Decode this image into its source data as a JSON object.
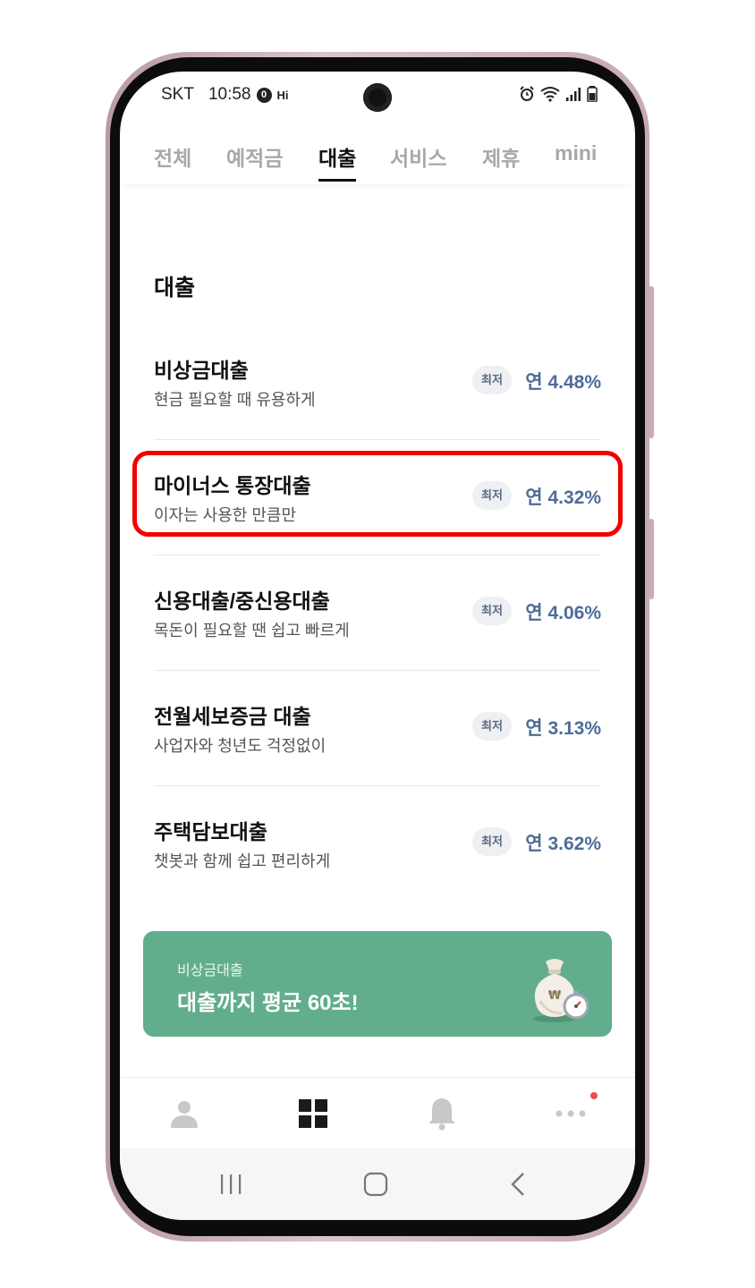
{
  "status_bar": {
    "carrier": "SKT",
    "time": "10:58",
    "hi_label": "Hi"
  },
  "tabs": [
    {
      "label": "전체",
      "active": false
    },
    {
      "label": "예적금",
      "active": false
    },
    {
      "label": "대출",
      "active": true
    },
    {
      "label": "서비스",
      "active": false
    },
    {
      "label": "제휴",
      "active": false
    },
    {
      "label": "mini",
      "active": false
    }
  ],
  "section": {
    "title": "대출"
  },
  "loans": [
    {
      "name": "비상금대출",
      "desc": "현금 필요할 때 유용하게",
      "badge": "최저",
      "rate": "연 4.48%"
    },
    {
      "name": "마이너스 통장대출",
      "desc": "이자는 사용한 만큼만",
      "badge": "최저",
      "rate": "연 4.32%"
    },
    {
      "name": "신용대출/중신용대출",
      "desc": "목돈이 필요할 땐 쉽고 빠르게",
      "badge": "최저",
      "rate": "연 4.06%"
    },
    {
      "name": "전월세보증금 대출",
      "desc": "사업자와 청년도 걱정없이",
      "badge": "최저",
      "rate": "연 3.13%"
    },
    {
      "name": "주택담보대출",
      "desc": "챗봇과 함께 쉽고 편리하게",
      "badge": "최저",
      "rate": "연 3.62%"
    }
  ],
  "banner": {
    "sub": "비상금대출",
    "main": "대출까지 평균 60초!",
    "icon": "money-bag-stopwatch-icon"
  },
  "bottom_nav": [
    {
      "icon": "person-icon"
    },
    {
      "icon": "grid-icon"
    },
    {
      "icon": "bell-icon"
    },
    {
      "icon": "more-icon"
    }
  ],
  "system_nav": [
    {
      "icon": "recents-icon"
    },
    {
      "icon": "home-icon"
    },
    {
      "icon": "back-icon"
    }
  ],
  "colors": {
    "accent_rate": "#4d6c99",
    "banner_bg": "#62ae8c",
    "highlight": "#f20000",
    "notification_dot": "#ef4b4b"
  }
}
